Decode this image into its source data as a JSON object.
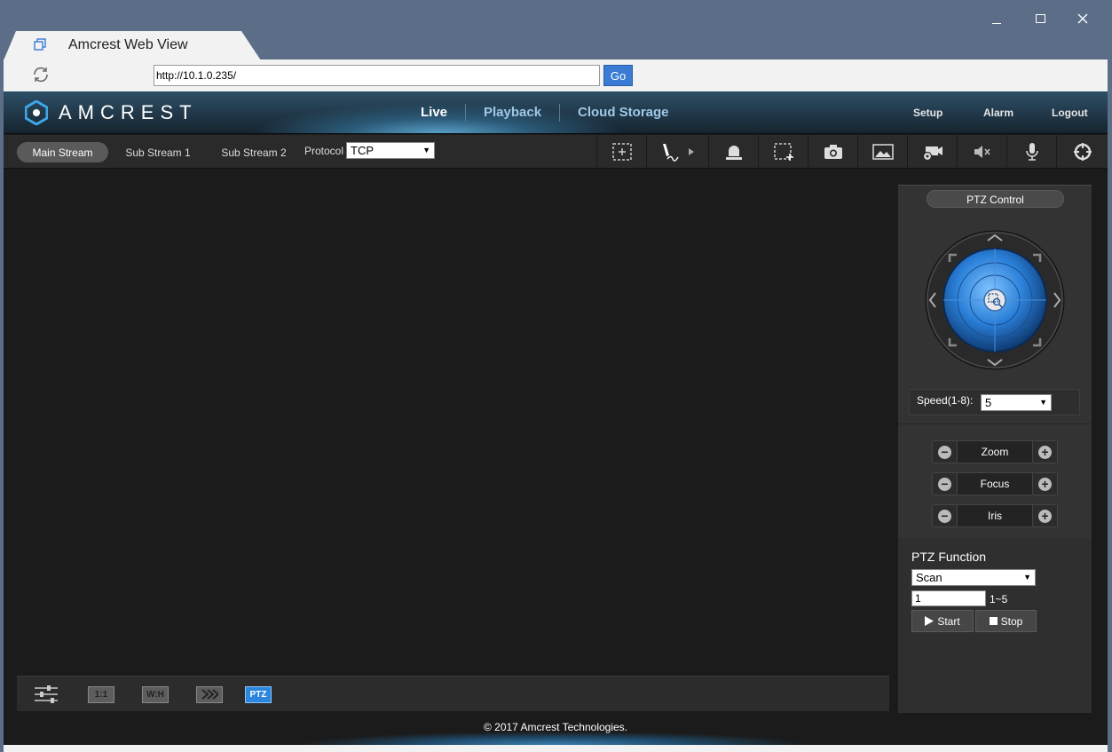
{
  "browser": {
    "tab_title": "Amcrest Web View",
    "url": "http://10.1.0.235/",
    "go_label": "Go"
  },
  "header": {
    "logo_text": "AMCREST",
    "nav": {
      "live": "Live",
      "playback": "Playback",
      "cloud": "Cloud Storage"
    },
    "setup": "Setup",
    "alarm": "Alarm",
    "logout": "Logout"
  },
  "toolbar": {
    "main_stream": "Main Stream",
    "sub_stream_1": "Sub Stream 1",
    "sub_stream_2": "Sub Stream 2",
    "protocol_label": "Protocol",
    "protocol_value": "TCP",
    "icons": [
      "digital-zoom-icon",
      "draw-icon",
      "alarm-bell-icon",
      "region-select-icon",
      "snapshot-camera-icon",
      "image-icon",
      "record-icon",
      "mute-icon",
      "microphone-icon",
      "target-icon"
    ]
  },
  "bottom_bar": {
    "ratio_1_1": "1:1",
    "ratio_wh": "W:H",
    "ptz": "PTZ"
  },
  "ptz": {
    "title": "PTZ Control",
    "speed_label": "Speed(1-8):",
    "speed_value": "5",
    "zoom": "Zoom",
    "focus": "Focus",
    "iris": "Iris",
    "function_title": "PTZ Function",
    "function_value": "Scan",
    "number_value": "1",
    "range": "1~5",
    "start": "Start",
    "stop": "Stop"
  },
  "footer": {
    "copyright": "© 2017 Amcrest Technologies."
  },
  "colors": {
    "accent": "#3a7bd5",
    "ptz_active": "#2b86de",
    "header_glow": "#5aa2c9"
  }
}
